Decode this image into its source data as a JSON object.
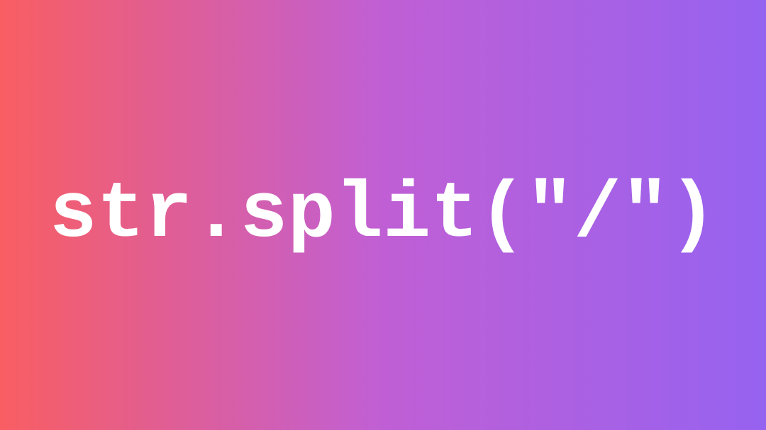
{
  "main": {
    "code_snippet": "str.split(\"/\")"
  }
}
